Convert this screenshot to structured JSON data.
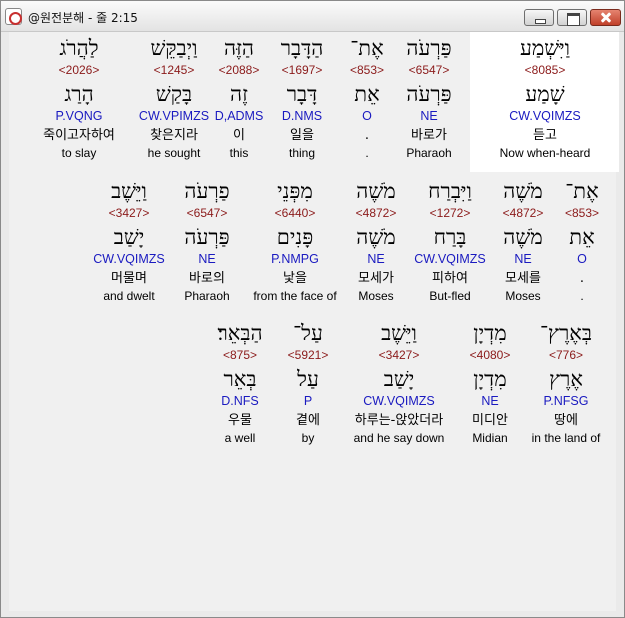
{
  "window": {
    "title": "@원전분해 - 줄 2:15"
  },
  "rows": [
    [
      {
        "heb": "וַיִּשְׁמַע",
        "num": "<8085>",
        "root": "שָׁמַע",
        "gram": "CW.VQIMZS",
        "kor": "듣고",
        "eng": "Now when-heard",
        "selected": true
      },
      {
        "heb": "פַּרְעֹה",
        "num": "<6547>",
        "root": "פַּרְעֹה",
        "gram": "NE",
        "kor": "바로가",
        "eng": "Pharaoh"
      },
      {
        "heb": "אֶת־",
        "num": "<853>",
        "root": "אֵת",
        "gram": "O",
        "kor": ".",
        "eng": "."
      },
      {
        "heb": "הַדָּבָר",
        "num": "<1697>",
        "root": "דָּבָר",
        "gram": "D.NMS",
        "kor": "일을",
        "eng": "thing"
      },
      {
        "heb": "הַזֶּה",
        "num": "<2088>",
        "root": "זֶה",
        "gram": "D,ADMS",
        "kor": "이",
        "eng": "this"
      },
      {
        "heb": "וַיְבַקֵּשׁ",
        "num": "<1245>",
        "root": "בָּקַשׁ",
        "gram": "CW.VPIMZS",
        "kor": "찾은지라",
        "eng": "he sought"
      },
      {
        "heb": "לַהֲרֹג",
        "num": "<2026>",
        "root": "הָרַג",
        "gram": "P.VQNG",
        "kor": "죽이고자하여",
        "eng": "to slay"
      }
    ],
    [
      {
        "heb": "אֶת־",
        "num": "<853>",
        "root": "אֵת",
        "gram": "O",
        "kor": ".",
        "eng": "."
      },
      {
        "heb": "מֹשֶׁה",
        "num": "<4872>",
        "root": "מֹשֶׁה",
        "gram": "NE",
        "kor": "모세를",
        "eng": "Moses"
      },
      {
        "heb": "וַיִּבְרַח",
        "num": "<1272>",
        "root": "בָּרַח",
        "gram": "CW.VQIMZS",
        "kor": "피하여",
        "eng": "But-fled"
      },
      {
        "heb": "מֹשֶׁה",
        "num": "<4872>",
        "root": "מֹשֶׁה",
        "gram": "NE",
        "kor": "모세가",
        "eng": "Moses"
      },
      {
        "heb": "מִפְּנֵי",
        "num": "<6440>",
        "root": "פָּנִים",
        "gram": "P.NMPG",
        "kor": "낯을",
        "eng": "from the face of"
      },
      {
        "heb": "פַרְעֹה",
        "num": "<6547>",
        "root": "פַּרְעֹה",
        "gram": "NE",
        "kor": "바로의",
        "eng": "Pharaoh"
      },
      {
        "heb": "וַיֵּשֶׁב",
        "num": "<3427>",
        "root": "יָשַׁב",
        "gram": "CW.VQIMZS",
        "kor": "머물며",
        "eng": "and dwelt"
      }
    ],
    [
      {
        "heb": "בְּאֶרֶץ־",
        "num": "<776>",
        "root": "אֶרֶץ",
        "gram": "P.NFSG",
        "kor": "땅에",
        "eng": "in the land of"
      },
      {
        "heb": "מִדְיָן",
        "num": "<4080>",
        "root": "מִדְיָן",
        "gram": "NE",
        "kor": "미디안",
        "eng": "Midian"
      },
      {
        "heb": "וַיֵּשֶׁב",
        "num": "<3427>",
        "root": "יָשַׁב",
        "gram": "CW.VQIMZS",
        "kor": "하루는-앉았더라",
        "eng": "and he say down"
      },
      {
        "heb": "עַל־",
        "num": "<5921>",
        "root": "עַל",
        "gram": "P",
        "kor": "곁에",
        "eng": "by"
      },
      {
        "heb": "הַבְּאֵר׃",
        "num": "<875>",
        "root": "בְּאֵר",
        "gram": "D.NFS",
        "kor": "우물",
        "eng": "a well"
      }
    ]
  ]
}
